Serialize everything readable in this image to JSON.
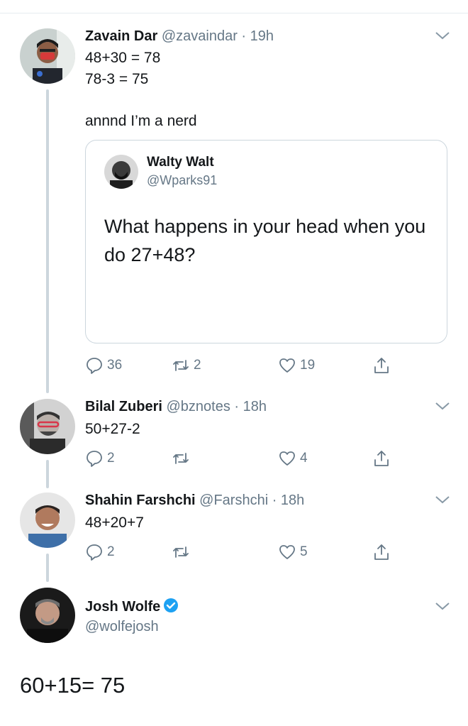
{
  "colors": {
    "text": "#14171a",
    "secondary": "#657786",
    "border": "#ccd6dd",
    "verified": "#1da1f2"
  },
  "tweets": [
    {
      "name": "Zavain Dar",
      "handle": "@zavaindar",
      "time": "· 19h",
      "lines": [
        "48+30 = 78",
        "78-3 = 75",
        "",
        "annnd I’m a nerd"
      ],
      "quote": {
        "name": "Walty Walt",
        "handle": "@Wparks91",
        "text_lines": [
          "What happens in your head when you",
          "do 27+48?"
        ]
      },
      "actions": {
        "replies": "36",
        "retweets": "2",
        "likes": "19"
      }
    },
    {
      "name": "Bilal Zuberi",
      "handle": "@bznotes",
      "time": "· 18h",
      "lines": [
        "50+27-2"
      ],
      "actions": {
        "replies": "2",
        "retweets": "",
        "likes": "4"
      }
    },
    {
      "name": "Shahin Farshchi",
      "handle": "@Farshchi",
      "time": "· 18h",
      "lines": [
        "48+20+7"
      ],
      "actions": {
        "replies": "2",
        "retweets": "",
        "likes": "5"
      }
    },
    {
      "name": "Josh Wolfe",
      "handle": "@wolfejosh",
      "verified": true,
      "text": "60+15= 75"
    }
  ]
}
